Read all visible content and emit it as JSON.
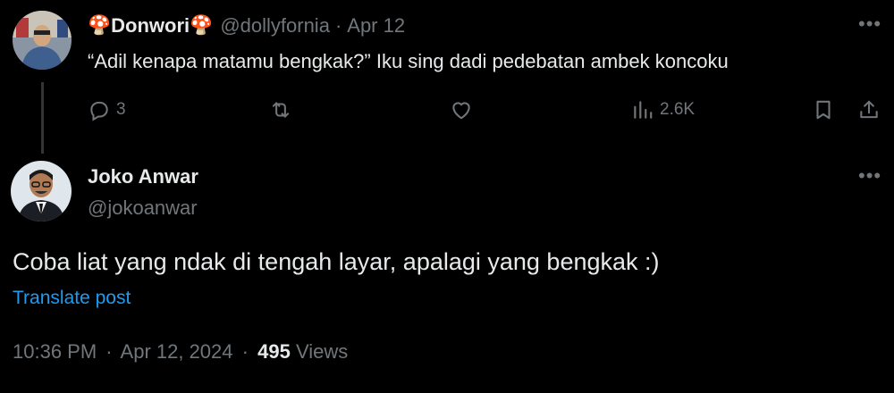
{
  "reply_parent": {
    "display_name": "Donwori",
    "name_emoji": "🍄",
    "handle": "@dollyfornia",
    "separator": "·",
    "date": "Apr 12",
    "text": "“Adil kenapa matamu bengkak?” Iku sing dadi pedebatan ambek koncoku",
    "actions": {
      "reply_count": "3",
      "retweet_count": "",
      "like_count": "",
      "views_count": "2.6K"
    }
  },
  "main_tweet": {
    "display_name": "Joko Anwar",
    "handle": "@jokoanwar",
    "text": "Coba liat yang ndak di tengah layar, apalagi yang bengkak :)",
    "translate_label": "Translate post",
    "time": "10:36 PM",
    "separator": "·",
    "date": "Apr 12, 2024",
    "separator2": "·",
    "views_count": "495",
    "views_label": "Views"
  },
  "icons": {
    "reply": "reply-icon",
    "retweet": "retweet-icon",
    "like": "heart-icon",
    "views": "views-chart-icon",
    "bookmark": "bookmark-icon",
    "share": "share-icon",
    "more": "more-icon"
  },
  "colors": {
    "background": "#000000",
    "text": "#e7e9ea",
    "muted": "#71767b",
    "link": "#1d9bf0",
    "thread_line": "#333639"
  }
}
